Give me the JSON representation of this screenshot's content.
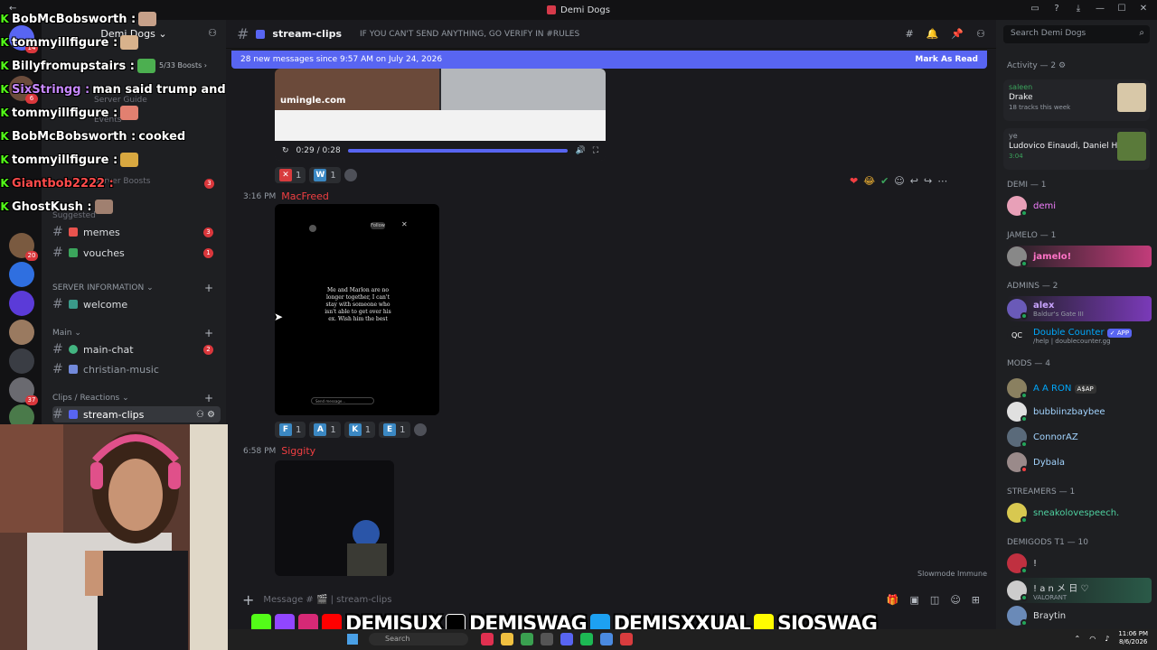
{
  "window": {
    "title": "Demi Dogs",
    "back": "←"
  },
  "server": {
    "name": "Demi Dogs ⌄",
    "boosts": "5/33 Boosts ›",
    "faded": {
      "server_guide": "Server Guide",
      "events": "Events",
      "server_boosts": "Server Boosts",
      "suggested": "Suggested"
    },
    "badges": {
      "rail_1": "14",
      "rail_2": "6",
      "rail_3": "20",
      "rail_4": "37",
      "boosts_count": "3"
    }
  },
  "channels": [
    {
      "label": "memes",
      "count": "3"
    },
    {
      "label": "vouches",
      "count": "1"
    },
    {
      "label": "welcome",
      "count": ""
    },
    {
      "label": "main-chat",
      "count": "2"
    },
    {
      "label": "christian-music",
      "count": ""
    },
    {
      "label": "stream-clips",
      "count": ""
    }
  ],
  "categories": {
    "server_info": "SERVER INFORMATION ⌄",
    "main": "Main ⌄",
    "clips": "Clips / Reactions ⌄"
  },
  "chat_overlay": [
    {
      "user": "BobMcBobsworth :",
      "msg": ""
    },
    {
      "user": "tommyillfigure :",
      "msg": ""
    },
    {
      "user": "Billyfromupstairs :",
      "msg": ""
    },
    {
      "user": "SixStringg :",
      "msg": "man said trump and ur room is messy"
    },
    {
      "user": "tommyillfigure :",
      "msg": ""
    },
    {
      "user": "BobMcBobsworth :",
      "msg": "cooked"
    },
    {
      "user": "tommyillfigure :",
      "msg": ""
    },
    {
      "user": "Giantbob2222 :",
      "msg": ""
    },
    {
      "user": "GhostKush :",
      "msg": ""
    }
  ],
  "header": {
    "channel": "stream-clips",
    "topic": "IF YOU CAN'T SEND ANYTHING, GO VERIFY IN #RULES",
    "search_placeholder": "Search Demi Dogs"
  },
  "new_messages": {
    "text": "28 new messages since 9:57 AM on July 24, 2026",
    "action": "Mark As Read"
  },
  "video": {
    "time": "0:29 / 0:28",
    "brand": "umingle.com"
  },
  "reactions_1": [
    {
      "letter": "✕",
      "count": "1"
    },
    {
      "letter": "W",
      "count": "1"
    }
  ],
  "message_2": {
    "time": "3:16 PM",
    "author": "MacFreed",
    "story_text": "Me and Marlon are no longer together, I can't stay with someone who isn't able to get over his ex. Wish him the best",
    "story_follow": "Follow",
    "story_send": "Send message..."
  },
  "reactions_2": [
    {
      "letter": "F",
      "count": "1"
    },
    {
      "letter": "A",
      "count": "1"
    },
    {
      "letter": "K",
      "count": "1"
    },
    {
      "letter": "E",
      "count": "1"
    }
  ],
  "message_3": {
    "time": "6:58 PM",
    "author": "Siggity"
  },
  "slowmode": "Slowmode Immune",
  "composer_placeholder": "Message # 🎬 | stream-clips",
  "members": {
    "activity_title": "Activity — 2 ⚙",
    "act1": {
      "user": "saleen",
      "title": "Drake",
      "sub": "18 tracks this week"
    },
    "act2": {
      "user": "ye",
      "title": "Ludovico Einaudi, Daniel H...",
      "sub": "3:04"
    },
    "groups": [
      {
        "title": "DEMI — 1",
        "items": [
          {
            "name": "demi",
            "sub": "",
            "color": "#f47fff"
          }
        ]
      },
      {
        "title": "JAMELO — 1",
        "items": [
          {
            "name": "jamelo!",
            "sub": "",
            "color": "#ff73c7"
          }
        ]
      },
      {
        "title": "ADMINS — 2",
        "items": [
          {
            "name": "alex",
            "sub": "Baldur's Gate III",
            "color": "#c9a4ff"
          },
          {
            "name": "Double Counter",
            "sub": "/help | doublecounter.gg",
            "color": "#00a8fc",
            "tag": "✓ APP"
          }
        ]
      },
      {
        "title": "MODS — 4",
        "items": [
          {
            "name": "A A RON",
            "sub": "",
            "color": "#00a8fc",
            "tag": "A$AP"
          },
          {
            "name": "bubbiinzbaybee",
            "sub": "",
            "color": "#a3d4ff"
          },
          {
            "name": "ConnorAZ",
            "sub": "",
            "color": "#a3d4ff"
          },
          {
            "name": "Dybala",
            "sub": "",
            "color": "#a3d4ff"
          }
        ]
      },
      {
        "title": "STREAMERS — 1",
        "items": [
          {
            "name": "sneakolovespeech.",
            "sub": "",
            "color": "#4fd1a0"
          }
        ]
      },
      {
        "title": "DEMIGODS T1 — 10",
        "items": [
          {
            "name": "!",
            "sub": "",
            "color": "#f2f3f5"
          },
          {
            "name": "! a n メ 日 ♡",
            "sub": "VALORANT",
            "color": "#f2f3f5"
          },
          {
            "name": "Braytin",
            "sub": "",
            "color": "#f2f3f5"
          }
        ]
      }
    ]
  },
  "banner": {
    "kick_handle": "DEMISUX",
    "tiktok_handle": "DEMISWAG",
    "twitter_handle": "DEMISXXUAL",
    "snap_handle": "SIOSWAG"
  },
  "taskbar": {
    "search": "Search",
    "time": "11:06 PM",
    "date": "8/6/2026"
  }
}
